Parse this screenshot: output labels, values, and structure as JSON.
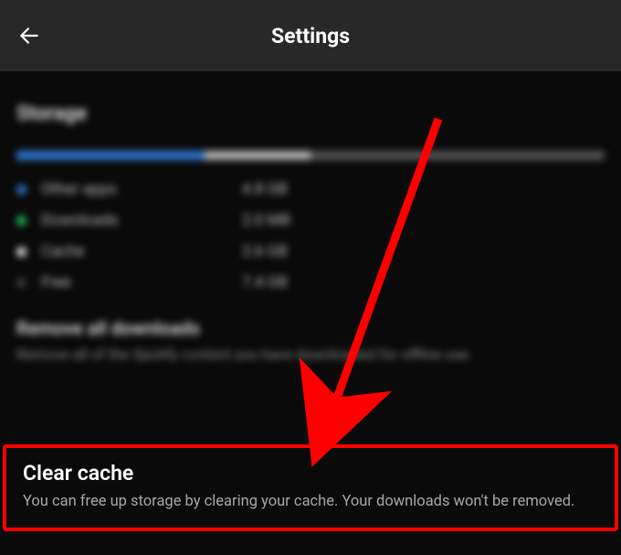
{
  "header": {
    "title": "Settings"
  },
  "storage": {
    "section_title": "Storage",
    "legend": [
      {
        "label": "Other apps",
        "value": "4.8 GB",
        "color": "blue"
      },
      {
        "label": "Downloads",
        "value": "2.0 MB",
        "color": "green"
      },
      {
        "label": "Cache",
        "value": "2.6 GB",
        "color": "white"
      },
      {
        "label": "Free",
        "value": "7.4 GB",
        "color": "dark"
      }
    ]
  },
  "remove_downloads": {
    "title": "Remove all downloads",
    "description": "Remove all of the Spotify content you have downloaded for offline use."
  },
  "clear_cache": {
    "title": "Clear cache",
    "description": "You can free up storage by clearing your cache. Your downloads won't be removed."
  }
}
